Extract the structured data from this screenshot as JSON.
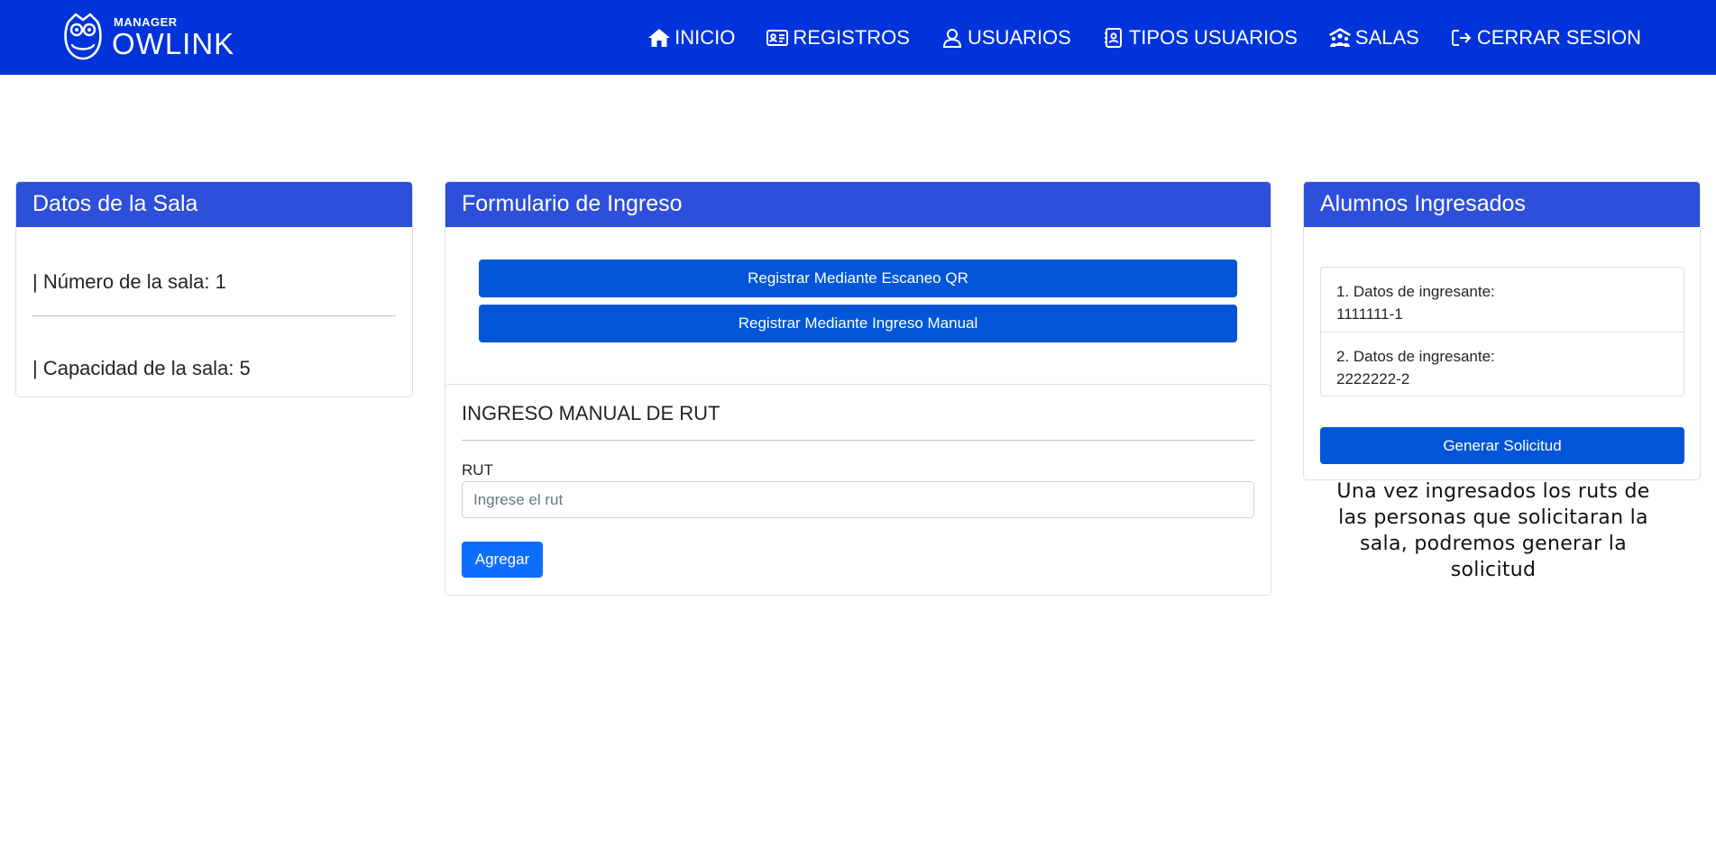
{
  "brand": {
    "small": "MANAGER",
    "big": "OWLINK",
    "logo_icon": "owl-icon"
  },
  "nav": {
    "items": [
      {
        "label": "INICIO",
        "icon": "home-icon"
      },
      {
        "label": "REGISTROS",
        "icon": "id-card-icon"
      },
      {
        "label": "USUARIOS",
        "icon": "user-icon"
      },
      {
        "label": "TIPOS USUARIOS",
        "icon": "contact-book-icon"
      },
      {
        "label": "SALAS",
        "icon": "people-roof-icon"
      },
      {
        "label": "CERRAR SESION",
        "icon": "logout-icon"
      }
    ]
  },
  "sala": {
    "title": "Datos de la Sala",
    "numero": "| Número de la sala: 1",
    "capacidad": "| Capacidad de la sala: 5"
  },
  "form": {
    "title": "Formulario de Ingreso",
    "btn_qr": "Registrar Mediante Escaneo QR",
    "btn_manual": "Registrar Mediante Ingreso Manual",
    "manual_title": "INGRESO MANUAL DE RUT",
    "rut_label": "RUT",
    "rut_value": "",
    "rut_placeholder": "Ingrese el rut",
    "btn_agregar": "Agregar"
  },
  "alumnos": {
    "title": "Alumnos Ingresados",
    "items": [
      {
        "label": "1. Datos de ingresante:",
        "rut": "1111111-1"
      },
      {
        "label": "2. Datos de ingresante:",
        "rut": "2222222-2"
      }
    ],
    "btn_solicitud": "Generar Solicitud",
    "helper": "Una vez ingresados los ruts de las personas que solicitaran la sala, podremos generar la solicitud"
  },
  "colors": {
    "navbar": "#0033d9",
    "card_header": "#2d4fd9",
    "primary_button": "#0056d6",
    "agregar_button": "#0d6efd"
  }
}
